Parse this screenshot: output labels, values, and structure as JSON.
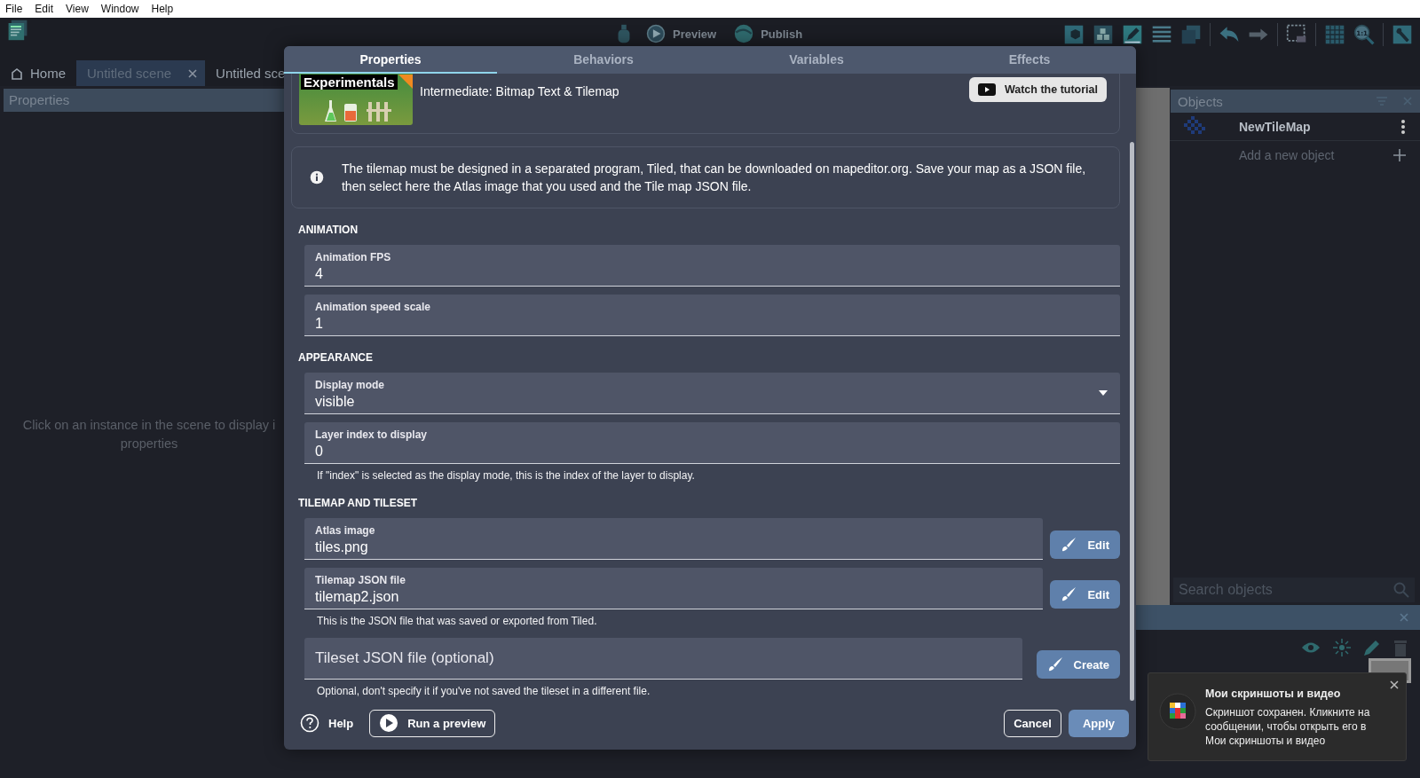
{
  "menu": [
    "File",
    "Edit",
    "View",
    "Window",
    "Help"
  ],
  "toolbar": {
    "preview": "Preview",
    "publish": "Publish",
    "zoom_label": "1:1"
  },
  "editor_tabs": [
    {
      "label": "Home",
      "kind": "home",
      "selected": false
    },
    {
      "label": "Untitled scene",
      "kind": "scene",
      "selected": true
    },
    {
      "label": "Untitled sce",
      "kind": "scene",
      "selected": false
    }
  ],
  "properties_panel": {
    "title": "Properties",
    "placeholder": "Click on an instance in the scene to display i\nproperties"
  },
  "objects_panel": {
    "title": "Objects",
    "objects": [
      {
        "name": "NewTileMap"
      }
    ],
    "add_label": "Add a new object",
    "search": {
      "placeholder": "Search objects"
    }
  },
  "dialog": {
    "tabs": [
      {
        "label": "Properties",
        "selected": true
      },
      {
        "label": "Behaviors",
        "selected": false
      },
      {
        "label": "Variables",
        "selected": false
      },
      {
        "label": "Effects",
        "selected": false
      }
    ],
    "extension": {
      "badge": "Experimentals",
      "title": "Intermediate: Bitmap Text & Tilemap",
      "tutorial_button": "Watch the tutorial"
    },
    "info": "The tilemap must be designed in a separated program, Tiled, that can be downloaded on mapeditor.org. Save your map as a JSON file, then select here the Atlas image that you used and the Tile map JSON file.",
    "sections": [
      {
        "title": "ANIMATION",
        "fields": [
          {
            "kind": "text",
            "label": "Animation FPS",
            "value": "4"
          },
          {
            "kind": "text",
            "label": "Animation speed scale",
            "value": "1"
          }
        ]
      },
      {
        "title": "APPEARANCE",
        "fields": [
          {
            "kind": "select",
            "label": "Display mode",
            "value": "visible"
          },
          {
            "kind": "text",
            "label": "Layer index to display",
            "value": "0",
            "helper": "If \"index\" is selected as the display mode, this is the index of the layer to display."
          }
        ]
      },
      {
        "title": "TILEMAP AND TILESET",
        "fields": [
          {
            "kind": "resource",
            "label": "Atlas image",
            "value": "tiles.png",
            "action": "Edit"
          },
          {
            "kind": "resource",
            "label": "Tilemap JSON file",
            "value": "tilemap2.json",
            "action": "Edit",
            "helper": "This is the JSON file that was saved or exported from Tiled."
          },
          {
            "kind": "resource",
            "label": "Tileset JSON file (optional)",
            "action": "Create",
            "helper": "Optional, don't specify it if you've not saved the tileset in a different file."
          }
        ]
      }
    ],
    "footer": {
      "help": "Help",
      "preview": "Run a preview",
      "cancel": "Cancel",
      "apply": "Apply"
    }
  },
  "notification": {
    "title": "Мои скриншоты и видео",
    "body": "Скриншот сохранен. Кликните на сообщении, чтобы открыть его в Мои скриншоты и видео"
  }
}
